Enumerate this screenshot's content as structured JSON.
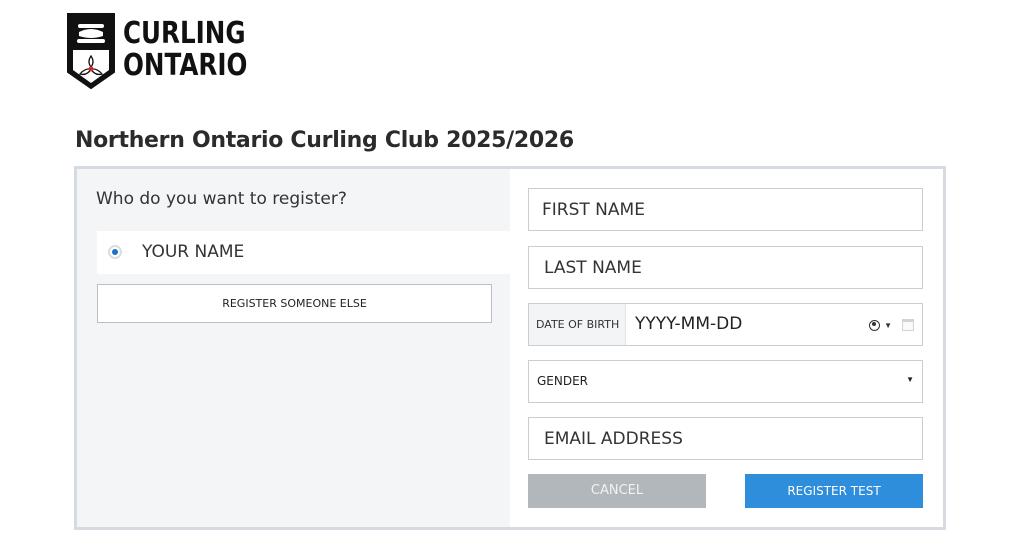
{
  "logo": {
    "line1": "CURLING",
    "line2": "ONTARIO"
  },
  "page_title": "Northern Ontario Curling Club 2025/2026",
  "left_pane": {
    "question": "Who do you want to register?",
    "selected_option_label": "YOUR NAME",
    "register_someone_else_label": "REGISTER SOMEONE ELSE"
  },
  "form": {
    "first_name_placeholder": "FIRST NAME",
    "last_name_placeholder": "LAST NAME",
    "dob_label": "DATE OF BIRTH",
    "dob_value": "YYYY-MM-DD",
    "gender_label": "GENDER",
    "email_placeholder": "EMAIL ADDRESS",
    "cancel_label": "CANCEL",
    "register_label": "REGISTER TEST"
  },
  "colors": {
    "primary_button": "#2f8edc",
    "disabled_button": "#b2b7bb",
    "radio_selected": "#1a73c8",
    "card_border": "#d5dbe0"
  },
  "icons": [
    "curling-stone-icon",
    "trillium-icon",
    "person-icon",
    "chevron-down-icon",
    "calendar-icon",
    "caret-down-icon"
  ]
}
